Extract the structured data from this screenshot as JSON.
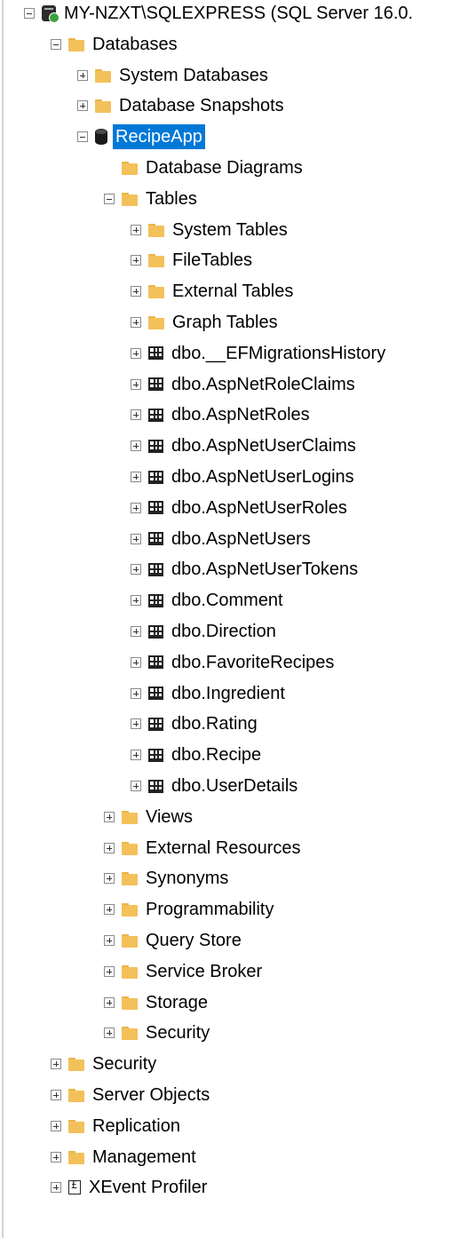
{
  "tree": [
    {
      "label": "MY-NZXT\\SQLEXPRESS (SQL Server 16.0.",
      "level": 0,
      "toggle": "minus",
      "icon": "server-icon"
    },
    {
      "label": "Databases",
      "level": 1,
      "toggle": "minus",
      "icon": "folder-icon"
    },
    {
      "label": "System Databases",
      "level": 2,
      "toggle": "plus",
      "icon": "folder-icon"
    },
    {
      "label": "Database Snapshots",
      "level": 2,
      "toggle": "plus",
      "icon": "folder-icon"
    },
    {
      "label": "RecipeApp",
      "level": 2,
      "toggle": "minus",
      "icon": "database-icon",
      "selected": true
    },
    {
      "label": "Database Diagrams",
      "level": 3,
      "toggle": "none",
      "icon": "folder-icon"
    },
    {
      "label": "Tables",
      "level": 3,
      "toggle": "minus",
      "icon": "folder-icon"
    },
    {
      "label": "System Tables",
      "level": 4,
      "toggle": "plus",
      "icon": "folder-icon"
    },
    {
      "label": "FileTables",
      "level": 4,
      "toggle": "plus",
      "icon": "folder-icon"
    },
    {
      "label": "External Tables",
      "level": 4,
      "toggle": "plus",
      "icon": "folder-icon"
    },
    {
      "label": "Graph Tables",
      "level": 4,
      "toggle": "plus",
      "icon": "folder-icon"
    },
    {
      "label": "dbo.__EFMigrationsHistory",
      "level": 4,
      "toggle": "plus",
      "icon": "table-icon"
    },
    {
      "label": "dbo.AspNetRoleClaims",
      "level": 4,
      "toggle": "plus",
      "icon": "table-icon"
    },
    {
      "label": "dbo.AspNetRoles",
      "level": 4,
      "toggle": "plus",
      "icon": "table-icon"
    },
    {
      "label": "dbo.AspNetUserClaims",
      "level": 4,
      "toggle": "plus",
      "icon": "table-icon"
    },
    {
      "label": "dbo.AspNetUserLogins",
      "level": 4,
      "toggle": "plus",
      "icon": "table-icon"
    },
    {
      "label": "dbo.AspNetUserRoles",
      "level": 4,
      "toggle": "plus",
      "icon": "table-icon"
    },
    {
      "label": "dbo.AspNetUsers",
      "level": 4,
      "toggle": "plus",
      "icon": "table-icon"
    },
    {
      "label": "dbo.AspNetUserTokens",
      "level": 4,
      "toggle": "plus",
      "icon": "table-icon"
    },
    {
      "label": "dbo.Comment",
      "level": 4,
      "toggle": "plus",
      "icon": "table-icon"
    },
    {
      "label": "dbo.Direction",
      "level": 4,
      "toggle": "plus",
      "icon": "table-icon"
    },
    {
      "label": "dbo.FavoriteRecipes",
      "level": 4,
      "toggle": "plus",
      "icon": "table-icon"
    },
    {
      "label": "dbo.Ingredient",
      "level": 4,
      "toggle": "plus",
      "icon": "table-icon"
    },
    {
      "label": "dbo.Rating",
      "level": 4,
      "toggle": "plus",
      "icon": "table-icon"
    },
    {
      "label": "dbo.Recipe",
      "level": 4,
      "toggle": "plus",
      "icon": "table-icon"
    },
    {
      "label": "dbo.UserDetails",
      "level": 4,
      "toggle": "plus",
      "icon": "table-icon"
    },
    {
      "label": "Views",
      "level": 3,
      "toggle": "plus",
      "icon": "folder-icon"
    },
    {
      "label": "External Resources",
      "level": 3,
      "toggle": "plus",
      "icon": "folder-icon"
    },
    {
      "label": "Synonyms",
      "level": 3,
      "toggle": "plus",
      "icon": "folder-icon"
    },
    {
      "label": "Programmability",
      "level": 3,
      "toggle": "plus",
      "icon": "folder-icon"
    },
    {
      "label": "Query Store",
      "level": 3,
      "toggle": "plus",
      "icon": "folder-icon"
    },
    {
      "label": "Service Broker",
      "level": 3,
      "toggle": "plus",
      "icon": "folder-icon"
    },
    {
      "label": "Storage",
      "level": 3,
      "toggle": "plus",
      "icon": "folder-icon"
    },
    {
      "label": "Security",
      "level": 3,
      "toggle": "plus",
      "icon": "folder-icon"
    },
    {
      "label": "Security",
      "level": 1,
      "toggle": "plus",
      "icon": "folder-icon"
    },
    {
      "label": "Server Objects",
      "level": 1,
      "toggle": "plus",
      "icon": "folder-icon"
    },
    {
      "label": "Replication",
      "level": 1,
      "toggle": "plus",
      "icon": "folder-icon"
    },
    {
      "label": "Management",
      "level": 1,
      "toggle": "plus",
      "icon": "folder-icon"
    },
    {
      "label": "XEvent Profiler",
      "level": 1,
      "toggle": "plus",
      "icon": "xevent-icon"
    }
  ]
}
